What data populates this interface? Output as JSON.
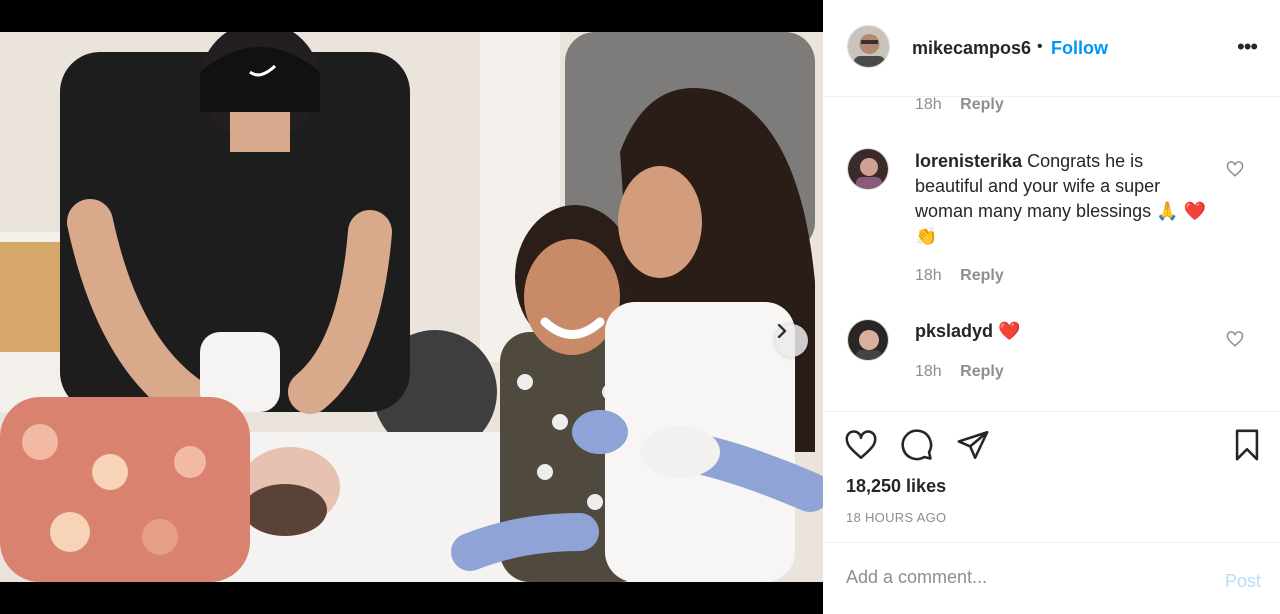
{
  "post": {
    "username": "mikecampos6",
    "separator": "•",
    "follow_label": "Follow",
    "more_label": "•••"
  },
  "carousel": {
    "slide_count": 3,
    "active_index": 0
  },
  "top_reply_meta": {
    "time": "18h",
    "reply_label": "Reply"
  },
  "comments": [
    {
      "username": "lorenisterika",
      "text": "Congrats he is beautiful and your wife a super woman many many blessings 🙏 ❤️👏",
      "time": "18h",
      "reply_label": "Reply"
    },
    {
      "username": "pksladyd",
      "text": "❤️",
      "time": "18h",
      "reply_label": "Reply"
    }
  ],
  "stats": {
    "likes": "18,250 likes",
    "posted_ago": "18 HOURS AGO"
  },
  "composer": {
    "placeholder": "Add a comment...",
    "post_label": "Post"
  },
  "icons": {
    "like": "heart-icon",
    "comment": "comment-bubble-icon",
    "share": "paper-plane-icon",
    "save": "bookmark-icon",
    "next": "chevron-right-icon"
  },
  "colors": {
    "accent": "#0095f6",
    "post_disabled": "#b2dffc",
    "muted_text": "#8e8e8e"
  }
}
